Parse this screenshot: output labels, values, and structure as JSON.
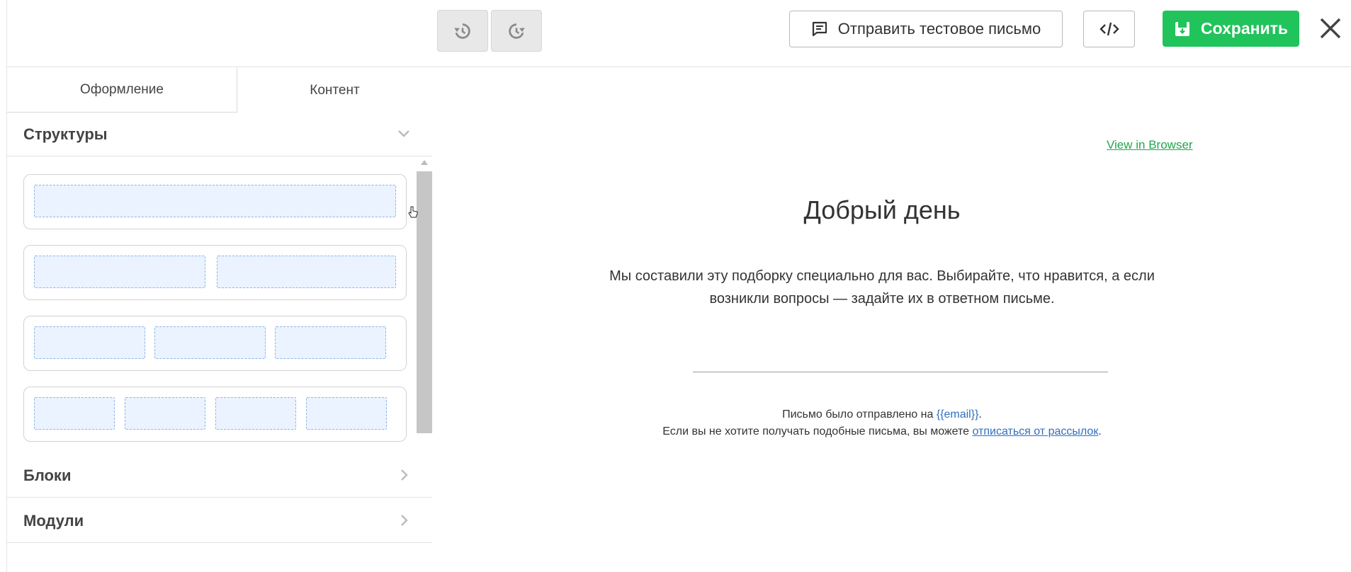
{
  "toolbar": {
    "undo_icon": "history-back-icon",
    "redo_icon": "history-forward-icon",
    "send_test_label": "Отправить тестовое письмо",
    "code_icon": "code-icon",
    "save_label": "Сохранить",
    "close_icon": "close-icon",
    "accent_color": "#21c35b"
  },
  "sidebar": {
    "tabs": [
      {
        "label": "Оформление"
      },
      {
        "label": "Контент"
      }
    ],
    "sections": [
      {
        "label": "Структуры",
        "expanded": true
      },
      {
        "label": "Блоки",
        "expanded": false
      },
      {
        "label": "Модули",
        "expanded": false
      }
    ],
    "structures": [
      {
        "columns": 1
      },
      {
        "columns": 2
      },
      {
        "columns": 3
      },
      {
        "columns": 4
      }
    ]
  },
  "email": {
    "view_in_browser": "View in Browser",
    "greeting": "Добрый день",
    "lead_line1": "Мы составили эту подборку специально для вас. Выбирайте, что нравится, а если",
    "lead_line2": "возникли вопросы — задайте их в ответном письме.",
    "footer_sent_prefix": "Письмо было отправлено на ",
    "footer_email_link": "{{email}}",
    "footer_sent_suffix": ".",
    "footer_unsub_prefix": "Если вы не хотите получать подобные письма, вы можете ",
    "footer_unsub_link": "отписаться от рассылок",
    "footer_unsub_suffix": "."
  }
}
